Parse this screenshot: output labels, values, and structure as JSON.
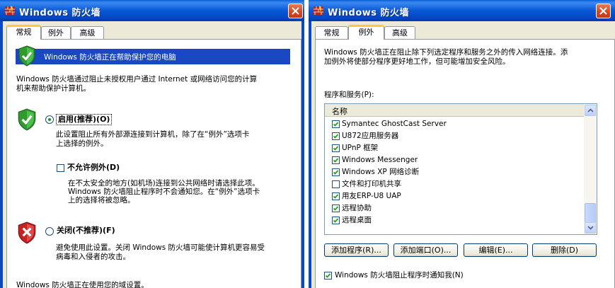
{
  "left_window": {
    "title": "Windows 防火墙",
    "tabs": [
      "常规",
      "例外",
      "高级"
    ],
    "active_tab": 0,
    "banner_text": "Windows 防火墙正在帮助保护您的电脑",
    "intro": [
      "Windows 防火墙通过阻止未授权用户通过 Internet 或网络访问您的计算",
      "机来帮助保护计算机。"
    ],
    "option_on": {
      "label": "启用(推荐)(O)",
      "selected": true,
      "desc": [
        "此设置阻止所有外部源连接到计算机，除了在“例外”选项卡",
        "上选择的例外。"
      ]
    },
    "no_exceptions": {
      "label": "不允许例外(D)",
      "checked": false,
      "desc": [
        "在不太安全的地方(如机场)连接到公共网络时请选择此项。",
        "Windows 防火墙阻止程序时不会通知您。在“例外”选项卡",
        "上的选择将被忽略。"
      ]
    },
    "option_off": {
      "label": "关闭(不推荐)(F)",
      "selected": false,
      "desc": [
        "避免使用此设置。关闭 Windows 防火墙可能使计算机更容易受",
        "病毒和入侵者的攻击。"
      ]
    },
    "footer": "Windows 防火墙正在使用您的域设置。"
  },
  "right_window": {
    "title": "Windows 防火墙",
    "tabs": [
      "常规",
      "例外",
      "高级"
    ],
    "active_tab": 1,
    "intro": [
      "Windows 防火墙正在阻止除下列选定程序和服务之外的传入网络连接。添",
      "加例外将使部分程序更好地工作，但可能增加安全风险。"
    ],
    "list_label": "程序和服务(P):",
    "column_header": "名称",
    "programs": [
      {
        "name": "Symantec GhostCast Server",
        "checked": true
      },
      {
        "name": "U872应用服务器",
        "checked": true
      },
      {
        "name": "UPnP 框架",
        "checked": true
      },
      {
        "name": "Windows Messenger",
        "checked": true
      },
      {
        "name": "Windows XP 网络诊断",
        "checked": true
      },
      {
        "name": "文件和打印机共享",
        "checked": false
      },
      {
        "name": "用友ERP-U8 UAP",
        "checked": true
      },
      {
        "name": "远程协助",
        "checked": true
      },
      {
        "name": "远程桌面",
        "checked": true
      }
    ],
    "buttons": {
      "add_program": "添加程序(R)...",
      "add_port": "添加端口(O)...",
      "edit": "编辑(E)...",
      "delete": "删除(D)"
    },
    "notify": {
      "label": "Windows 防火墙阻止程序时通知我(N)",
      "checked": true
    }
  },
  "colors": {
    "titlebar": "#0a57d6",
    "banner": "#1a48c2",
    "dialog_bg": "#ece9d8",
    "tab_accent": "#ffc83c",
    "close_button": "#d6451f"
  },
  "icons": {
    "title": "firewall-brick-icon",
    "close": "close-x-icon",
    "shield_on": "green-shield-check-icon",
    "shield_off": "red-shield-x-icon"
  }
}
